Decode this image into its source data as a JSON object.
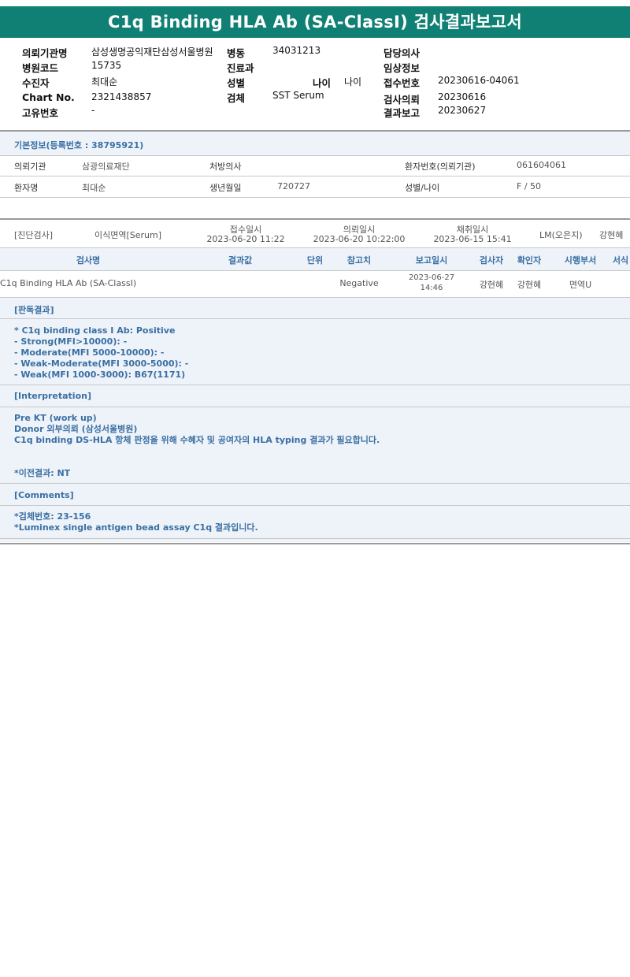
{
  "title": "C1q Binding HLA Ab (SA-ClassI) 검사결과보고서",
  "header": {
    "col1": [
      {
        "label": "의뢰기관명",
        "value": "삼성생명공익재단삼성서울병원"
      },
      {
        "label": "병원코드",
        "value": "15735"
      },
      {
        "label": "수진자",
        "value": "최대순"
      },
      {
        "label": "Chart No.",
        "value": "2321438857"
      },
      {
        "label": "고유번호",
        "value": "-"
      }
    ],
    "col2": [
      {
        "label": "병동",
        "value": "34031213"
      },
      {
        "label": "진료과",
        "value": ""
      },
      {
        "label": "성별",
        "value": ""
      },
      {
        "label": "검체",
        "value": "SST Serum"
      }
    ],
    "age": {
      "label": "나이",
      "value": "나이"
    },
    "col3": [
      {
        "label": "담당의사",
        "value": ""
      },
      {
        "label": "임상정보",
        "value": ""
      },
      {
        "label": "접수번호",
        "value": "20230616-04061"
      },
      {
        "label": "검사의뢰",
        "value": "20230616"
      },
      {
        "label": "결과보고",
        "value": "20230627"
      }
    ]
  },
  "basic_info": {
    "heading": "기본정보(등록번호 : 38795921)",
    "row1": {
      "l1": "의뢰기관",
      "v1": "삼광의료재단",
      "l2": "처방의사",
      "v2": "",
      "l3": "환자번호(의뢰기관)",
      "v3": "061604061"
    },
    "row2": {
      "l1": "환자명",
      "v1": "최대순",
      "l2": "생년월일",
      "v2": "720727",
      "l3": "성별/나이",
      "v3": "F / 50"
    }
  },
  "order": {
    "category": "[진단검사]",
    "dept": "이식면역[Serum]",
    "received_label": "접수일시",
    "received": "2023-06-20 11:22",
    "requested_label": "의뢰일시",
    "requested": "2023-06-20 10:22:00",
    "collected_label": "채취일시",
    "collected": "2023-06-15 15:41",
    "lm": "LM(오은지)",
    "tester": "강현혜"
  },
  "table": {
    "headers": [
      "검사명",
      "결과값",
      "단위",
      "참고치",
      "보고일시",
      "검사자",
      "확인자",
      "시행부서",
      "서식"
    ],
    "row": {
      "name": "C1q Binding HLA Ab (SA-ClassI)",
      "result": "",
      "unit": "",
      "reference": "Negative",
      "report_date": "2023-06-27",
      "report_time": "14:46",
      "tester": "강현혜",
      "confirmer": "강현혜",
      "dept": "면역U",
      "form": ""
    }
  },
  "sections": {
    "judgement_head": "[판독결과]",
    "judgement_lines": [
      "* C1q binding class I Ab: Positive",
      "- Strong(MFI>10000): -",
      "- Moderate(MFI 5000-10000): -",
      "- Weak-Moderate(MFI 3000-5000): -",
      "- Weak(MFI 1000-3000): B67(1171)"
    ],
    "interp_head": "[Interpretation]",
    "interp_lines": [
      "Pre KT (work up)",
      "Donor 외부의뢰 (삼성서울병원)",
      "C1q binding DS-HLA 항체 판정을 위해 수혜자 및 공여자의 HLA typing 결과가 필요합니다."
    ],
    "prev_result": "*이전결과: NT",
    "comments_head": "[Comments]",
    "comments_lines": [
      "*검체번호: 23-156",
      "*Luminex single antigen bead assay C1q 결과입니다."
    ]
  }
}
